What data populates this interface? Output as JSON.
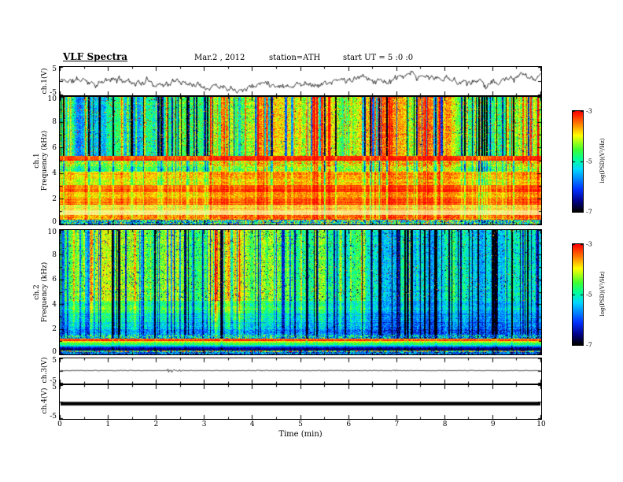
{
  "header": {
    "title": "VLF Spectra",
    "date": "Mar.2  , 2012",
    "station": "station=ATH",
    "start_ut": "start UT =  5 :0 :0"
  },
  "xaxis": {
    "label": "Time (min)",
    "min": 0,
    "max": 10,
    "ticks": [
      0,
      1,
      2,
      3,
      4,
      5,
      6,
      7,
      8,
      9,
      10
    ]
  },
  "colorbar": {
    "label": "log(PSD)(V²/Hz)",
    "ticks": [
      -3,
      -5,
      -7
    ],
    "min": -7,
    "max": -3,
    "stops": [
      [
        0,
        "#000000"
      ],
      [
        0.1,
        "#000085"
      ],
      [
        0.22,
        "#0030ff"
      ],
      [
        0.42,
        "#00d8ff"
      ],
      [
        0.52,
        "#00ff9a"
      ],
      [
        0.62,
        "#40ff30"
      ],
      [
        0.76,
        "#ffff00"
      ],
      [
        0.88,
        "#ff7800"
      ],
      [
        1,
        "#ff0000"
      ]
    ]
  },
  "chart_data": [
    {
      "id": "ch1_waveform",
      "type": "line",
      "ylabel": "ch.1(V)",
      "ylim": [
        -5,
        5
      ],
      "yticks": [
        5,
        -5
      ],
      "xlim": [
        0,
        10
      ],
      "seed": 11,
      "synth": {
        "kind": "noisy",
        "step": 1.5,
        "damp": 0.945,
        "jitter": 1.2,
        "clip": 4.7
      }
    },
    {
      "id": "ch1_spectrogram",
      "type": "heatmap",
      "ylabel_top": "ch.1",
      "ylabel": "Frequency (kHz)",
      "ylim": [
        0,
        10
      ],
      "yticks": [
        10,
        8,
        6,
        4,
        2,
        0
      ],
      "xlim": [
        0,
        10
      ],
      "value_range": [
        -7,
        -3
      ],
      "seed": 22,
      "row_noise": 0.04,
      "streaks": {
        "count": 170,
        "dark_prob": 0.5,
        "dark_min": 0.3,
        "dark_rand": 0.45,
        "bright_min": 0.12,
        "bright_rand": 0.2
      },
      "bands": [
        {
          "f0": 5.35,
          "f1": 10.01,
          "v": 0.6,
          "n": 0.1,
          "sm": 1.0,
          "spk_hi": 0.045,
          "spk_lo": 0.015
        },
        {
          "f0": 5.0,
          "f1": 5.35,
          "v": 0.96,
          "n": 0.05,
          "sm": 0.15
        },
        {
          "f0": 4.55,
          "f1": 5.0,
          "v": 0.72,
          "n": 0.17,
          "sm": 0.45
        },
        {
          "f0": 4.1,
          "f1": 4.55,
          "v": 0.64,
          "n": 0.13,
          "sm": 0.5
        },
        {
          "f0": 3.55,
          "f1": 4.1,
          "v": 0.83,
          "n": 0.09,
          "sm": 0.25
        },
        {
          "f0": 3.05,
          "f1": 3.55,
          "v": 0.77,
          "n": 0.1,
          "sm": 0.3
        },
        {
          "f0": 2.5,
          "f1": 3.05,
          "v": 0.92,
          "n": 0.06,
          "sm": 0.2
        },
        {
          "f0": 2.0,
          "f1": 2.5,
          "v": 0.85,
          "n": 0.08,
          "sm": 0.2
        },
        {
          "f0": 1.55,
          "f1": 2.0,
          "v": 0.9,
          "n": 0.06,
          "sm": 0.2
        },
        {
          "f0": 1.1,
          "f1": 1.55,
          "v": 0.8,
          "n": 0.08,
          "sm": 0.2,
          "w": 0.2
        },
        {
          "f0": 0.7,
          "f1": 1.1,
          "v": 0.78,
          "n": 0.06,
          "sm": 0.15,
          "w": 0.5
        },
        {
          "f0": 0.35,
          "f1": 0.7,
          "v": 0.88,
          "n": 0.1,
          "sm": 0.2
        },
        {
          "f0": 0.0,
          "f1": 0.35,
          "v": 0.5,
          "n": 0.35,
          "sm": 0.3
        }
      ]
    },
    {
      "id": "ch2_spectrogram",
      "type": "heatmap",
      "ylabel_top": "ch.2",
      "ylabel": "Frequency (kHz)",
      "ylim": [
        0,
        10
      ],
      "yticks": [
        10,
        8,
        6,
        4,
        2,
        0
      ],
      "xlim": [
        0,
        10
      ],
      "value_range": [
        -7,
        -3
      ],
      "seed": 33,
      "row_noise": 0.04,
      "streaks": {
        "count": 160,
        "dark_prob": 0.72,
        "dark_min": 0.25,
        "dark_rand": 0.35,
        "bright_min": 0.1,
        "bright_rand": 0.15
      },
      "bands": [
        {
          "f0": 4.3,
          "f1": 10.01,
          "v": 0.52,
          "n": 0.1,
          "sm": 1.0,
          "spk_hi": 0.012,
          "spk_lo": 0.04
        },
        {
          "f0": 3.3,
          "f1": 4.3,
          "v": 0.46,
          "n": 0.11,
          "sm": 0.8
        },
        {
          "f0": 2.6,
          "f1": 3.3,
          "v": 0.4,
          "n": 0.12,
          "sm": 0.7
        },
        {
          "f0": 2.0,
          "f1": 2.6,
          "v": 0.35,
          "n": 0.13,
          "sm": 0.6
        },
        {
          "f0": 1.55,
          "f1": 2.0,
          "v": 0.3,
          "n": 0.14,
          "sm": 0.5
        },
        {
          "f0": 1.25,
          "f1": 1.55,
          "v": 0.4,
          "n": 0.28,
          "sm": 0.4
        },
        {
          "f0": 1.05,
          "f1": 1.25,
          "v": 0.95,
          "n": 0.05,
          "sm": 0.1
        },
        {
          "f0": 0.9,
          "f1": 1.05,
          "v": 0.74,
          "n": 0.07,
          "sm": 0.1
        },
        {
          "f0": 0.75,
          "f1": 0.9,
          "v": 0.58,
          "n": 0.07,
          "sm": 0.1
        },
        {
          "f0": 0.6,
          "f1": 0.75,
          "v": 0.42,
          "n": 0.08,
          "sm": 0.1
        },
        {
          "f0": 0.45,
          "f1": 0.6,
          "v": 0.2,
          "n": 0.08,
          "sm": 0.1
        },
        {
          "f0": 0.3,
          "f1": 0.45,
          "v": 0.08,
          "n": 0.05,
          "sm": 0.1
        },
        {
          "f0": 0.15,
          "f1": 0.3,
          "v": 0.55,
          "n": 0.45,
          "sm": 0.1
        },
        {
          "f0": 0.0,
          "f1": 0.15,
          "v": 0.3,
          "n": 0.25,
          "sm": 0.1
        }
      ]
    },
    {
      "id": "ch3_waveform",
      "type": "line",
      "ylabel": "ch.3(V)",
      "ylim": [
        -5,
        5
      ],
      "yticks": [
        5,
        -5
      ],
      "xlim": [
        0,
        10
      ],
      "seed": 44,
      "synth": {
        "kind": "quiet",
        "amplitude": 0.12,
        "bursts": [
          {
            "t": 2.3,
            "w": 0.06,
            "a": 0.9
          },
          {
            "t": 2.5,
            "w": 0.04,
            "a": 0.5
          },
          {
            "t": 4.15,
            "w": 0.04,
            "a": 0.3
          },
          {
            "t": 5.6,
            "w": 0.03,
            "a": 0.25
          },
          {
            "t": 7.0,
            "w": 0.04,
            "a": 0.3
          },
          {
            "t": 8.6,
            "w": 0.03,
            "a": 0.25
          }
        ]
      }
    },
    {
      "id": "ch4_waveform",
      "type": "line",
      "ylabel": "ch.4(V)",
      "ylim": [
        -5,
        5
      ],
      "yticks": [
        5,
        -5
      ],
      "xlim": [
        0,
        10
      ],
      "seed": 55,
      "synth": {
        "kind": "flat",
        "value": -0.6,
        "thickness": 4.5
      }
    }
  ]
}
